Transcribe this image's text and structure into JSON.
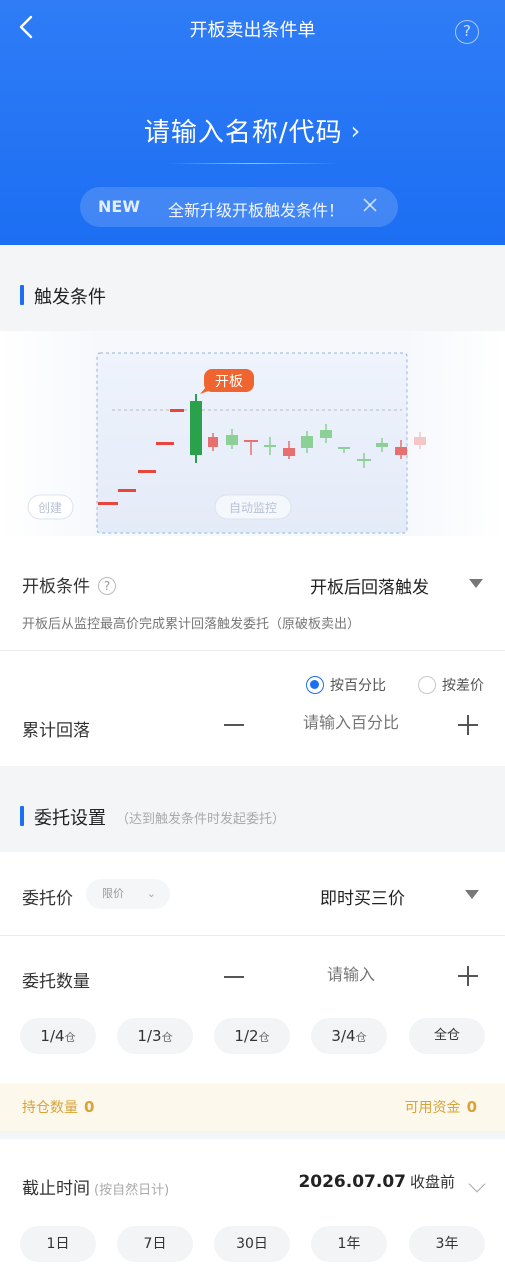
{
  "header": {
    "title": "开板卖出条件单",
    "help": "?",
    "search_prompt": "请输入名称/代码",
    "notice_badge": "NEW",
    "notice_text": "全新升级开板触发条件！"
  },
  "trigger_section": {
    "title": "触发条件",
    "chart": {
      "tag": "开板",
      "left_label": "创建",
      "monitor_label": "自动监控"
    }
  },
  "open_condition": {
    "label": "开板条件",
    "help": "?",
    "value": "开板后回落触发",
    "hint": "开板后从监控最高价完成累计回落触发委托（原破板卖出）"
  },
  "pullback": {
    "radio_percent": "按百分比",
    "radio_diff": "按差价",
    "label": "累计回落",
    "placeholder": "请输入百分比"
  },
  "order_section": {
    "title": "委托设置",
    "subtitle": "（达到触发条件时发起委托）"
  },
  "order_price": {
    "label": "委托价",
    "type": "限价",
    "value": "即时买三价"
  },
  "order_qty": {
    "label": "委托数量",
    "placeholder": "请输入",
    "chips": [
      {
        "main": "1/4",
        "suffix": "仓"
      },
      {
        "main": "1/3",
        "suffix": "仓"
      },
      {
        "main": "1/2",
        "suffix": "仓"
      },
      {
        "main": "3/4",
        "suffix": "仓"
      },
      {
        "main": "全仓",
        "suffix": ""
      }
    ]
  },
  "holdings": {
    "position_label": "持仓数量",
    "position_value": "0",
    "funds_label": "可用资金",
    "funds_value": "0"
  },
  "expiry": {
    "label": "截止时间",
    "note": "(按自然日计)",
    "date": "2026.07.07",
    "date_suffix": "收盘前",
    "chips": [
      "1日",
      "7日",
      "30日",
      "1年",
      "3年"
    ]
  },
  "colors": {
    "brand_blue": "#1c6ef3",
    "rise_red": "#e8453c",
    "fall_green": "#2aa14b",
    "tag_orange": "#f0652f",
    "holding_text": "#d9a339"
  }
}
